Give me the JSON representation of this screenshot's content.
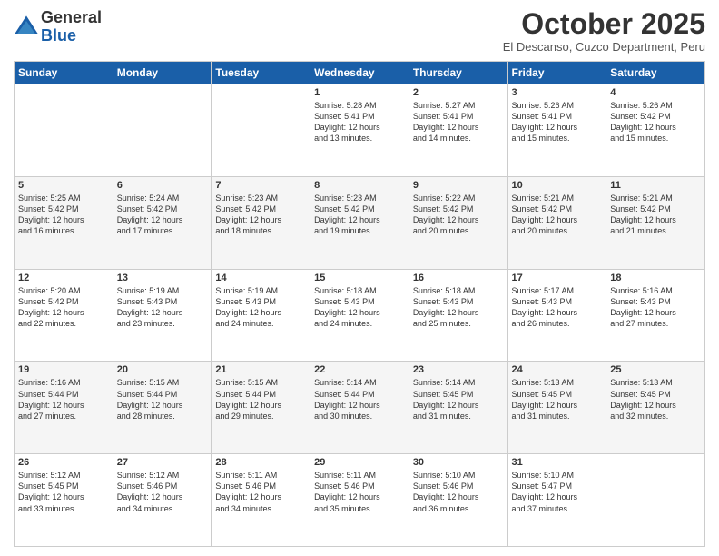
{
  "logo": {
    "text_general": "General",
    "text_blue": "Blue"
  },
  "header": {
    "month_title": "October 2025",
    "location": "El Descanso, Cuzco Department, Peru"
  },
  "weekdays": [
    "Sunday",
    "Monday",
    "Tuesday",
    "Wednesday",
    "Thursday",
    "Friday",
    "Saturday"
  ],
  "weeks": [
    [
      {
        "day": "",
        "info": ""
      },
      {
        "day": "",
        "info": ""
      },
      {
        "day": "",
        "info": ""
      },
      {
        "day": "1",
        "info": "Sunrise: 5:28 AM\nSunset: 5:41 PM\nDaylight: 12 hours\nand 13 minutes."
      },
      {
        "day": "2",
        "info": "Sunrise: 5:27 AM\nSunset: 5:41 PM\nDaylight: 12 hours\nand 14 minutes."
      },
      {
        "day": "3",
        "info": "Sunrise: 5:26 AM\nSunset: 5:41 PM\nDaylight: 12 hours\nand 15 minutes."
      },
      {
        "day": "4",
        "info": "Sunrise: 5:26 AM\nSunset: 5:42 PM\nDaylight: 12 hours\nand 15 minutes."
      }
    ],
    [
      {
        "day": "5",
        "info": "Sunrise: 5:25 AM\nSunset: 5:42 PM\nDaylight: 12 hours\nand 16 minutes."
      },
      {
        "day": "6",
        "info": "Sunrise: 5:24 AM\nSunset: 5:42 PM\nDaylight: 12 hours\nand 17 minutes."
      },
      {
        "day": "7",
        "info": "Sunrise: 5:23 AM\nSunset: 5:42 PM\nDaylight: 12 hours\nand 18 minutes."
      },
      {
        "day": "8",
        "info": "Sunrise: 5:23 AM\nSunset: 5:42 PM\nDaylight: 12 hours\nand 19 minutes."
      },
      {
        "day": "9",
        "info": "Sunrise: 5:22 AM\nSunset: 5:42 PM\nDaylight: 12 hours\nand 20 minutes."
      },
      {
        "day": "10",
        "info": "Sunrise: 5:21 AM\nSunset: 5:42 PM\nDaylight: 12 hours\nand 20 minutes."
      },
      {
        "day": "11",
        "info": "Sunrise: 5:21 AM\nSunset: 5:42 PM\nDaylight: 12 hours\nand 21 minutes."
      }
    ],
    [
      {
        "day": "12",
        "info": "Sunrise: 5:20 AM\nSunset: 5:42 PM\nDaylight: 12 hours\nand 22 minutes."
      },
      {
        "day": "13",
        "info": "Sunrise: 5:19 AM\nSunset: 5:43 PM\nDaylight: 12 hours\nand 23 minutes."
      },
      {
        "day": "14",
        "info": "Sunrise: 5:19 AM\nSunset: 5:43 PM\nDaylight: 12 hours\nand 24 minutes."
      },
      {
        "day": "15",
        "info": "Sunrise: 5:18 AM\nSunset: 5:43 PM\nDaylight: 12 hours\nand 24 minutes."
      },
      {
        "day": "16",
        "info": "Sunrise: 5:18 AM\nSunset: 5:43 PM\nDaylight: 12 hours\nand 25 minutes."
      },
      {
        "day": "17",
        "info": "Sunrise: 5:17 AM\nSunset: 5:43 PM\nDaylight: 12 hours\nand 26 minutes."
      },
      {
        "day": "18",
        "info": "Sunrise: 5:16 AM\nSunset: 5:43 PM\nDaylight: 12 hours\nand 27 minutes."
      }
    ],
    [
      {
        "day": "19",
        "info": "Sunrise: 5:16 AM\nSunset: 5:44 PM\nDaylight: 12 hours\nand 27 minutes."
      },
      {
        "day": "20",
        "info": "Sunrise: 5:15 AM\nSunset: 5:44 PM\nDaylight: 12 hours\nand 28 minutes."
      },
      {
        "day": "21",
        "info": "Sunrise: 5:15 AM\nSunset: 5:44 PM\nDaylight: 12 hours\nand 29 minutes."
      },
      {
        "day": "22",
        "info": "Sunrise: 5:14 AM\nSunset: 5:44 PM\nDaylight: 12 hours\nand 30 minutes."
      },
      {
        "day": "23",
        "info": "Sunrise: 5:14 AM\nSunset: 5:45 PM\nDaylight: 12 hours\nand 31 minutes."
      },
      {
        "day": "24",
        "info": "Sunrise: 5:13 AM\nSunset: 5:45 PM\nDaylight: 12 hours\nand 31 minutes."
      },
      {
        "day": "25",
        "info": "Sunrise: 5:13 AM\nSunset: 5:45 PM\nDaylight: 12 hours\nand 32 minutes."
      }
    ],
    [
      {
        "day": "26",
        "info": "Sunrise: 5:12 AM\nSunset: 5:45 PM\nDaylight: 12 hours\nand 33 minutes."
      },
      {
        "day": "27",
        "info": "Sunrise: 5:12 AM\nSunset: 5:46 PM\nDaylight: 12 hours\nand 34 minutes."
      },
      {
        "day": "28",
        "info": "Sunrise: 5:11 AM\nSunset: 5:46 PM\nDaylight: 12 hours\nand 34 minutes."
      },
      {
        "day": "29",
        "info": "Sunrise: 5:11 AM\nSunset: 5:46 PM\nDaylight: 12 hours\nand 35 minutes."
      },
      {
        "day": "30",
        "info": "Sunrise: 5:10 AM\nSunset: 5:46 PM\nDaylight: 12 hours\nand 36 minutes."
      },
      {
        "day": "31",
        "info": "Sunrise: 5:10 AM\nSunset: 5:47 PM\nDaylight: 12 hours\nand 37 minutes."
      },
      {
        "day": "",
        "info": ""
      }
    ]
  ]
}
